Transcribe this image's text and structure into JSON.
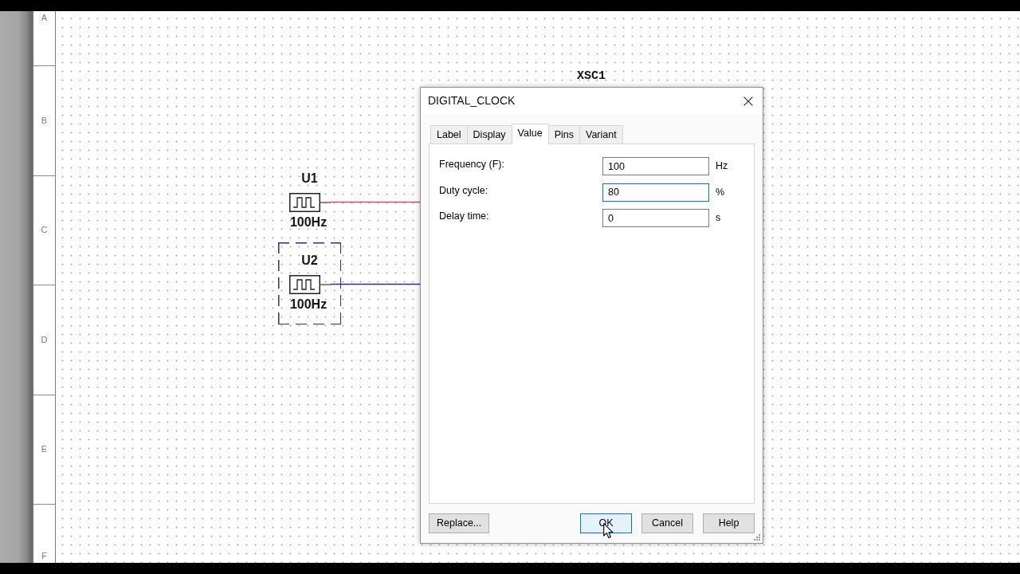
{
  "ruler": {
    "rows": [
      "A",
      "B",
      "C",
      "D",
      "E",
      "F"
    ]
  },
  "schematic": {
    "instrument": {
      "label": "XSC1"
    },
    "components": [
      {
        "ref": "U1",
        "value": "100Hz",
        "selected": false,
        "color": "#d9486e"
      },
      {
        "ref": "U2",
        "value": "100Hz",
        "selected": true,
        "color": "#2e2e8f"
      }
    ]
  },
  "dialog": {
    "title": "DIGITAL_CLOCK",
    "tabs": [
      {
        "label": "Label",
        "selected": false
      },
      {
        "label": "Display",
        "selected": false
      },
      {
        "label": "Value",
        "selected": true
      },
      {
        "label": "Pins",
        "selected": false
      },
      {
        "label": "Variant",
        "selected": false
      }
    ],
    "fields": [
      {
        "label": "Frequency (F):",
        "value": "100",
        "unit": "Hz",
        "focused": false
      },
      {
        "label": "Duty cycle:",
        "value": "80",
        "unit": "%",
        "focused": true
      },
      {
        "label": "Delay time:",
        "value": "0",
        "unit": "s",
        "focused": false
      }
    ],
    "buttons": [
      {
        "label": "Replace...",
        "hovered": false
      },
      {
        "label": "OK",
        "hovered": true
      },
      {
        "label": "Cancel",
        "hovered": false
      },
      {
        "label": "Help",
        "hovered": false
      }
    ]
  }
}
